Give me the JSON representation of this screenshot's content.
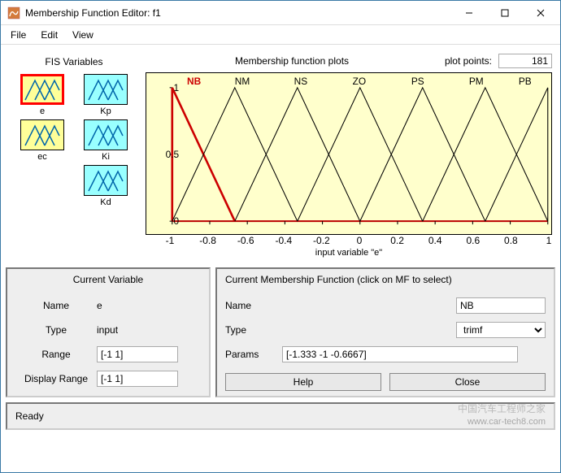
{
  "window": {
    "title": "Membership Function Editor: f1"
  },
  "menu": {
    "file": "File",
    "edit": "Edit",
    "view": "View"
  },
  "fis_header": "FIS Variables",
  "vars": [
    {
      "name": "e",
      "type": "input",
      "selected": true
    },
    {
      "name": "Kp",
      "type": "output",
      "selected": false
    },
    {
      "name": "ec",
      "type": "input",
      "selected": false
    },
    {
      "name": "Ki",
      "type": "output",
      "selected": false
    },
    {
      "name": "Kd",
      "type": "output",
      "selected": false
    }
  ],
  "plot": {
    "title": "Membership function plots",
    "points_label": "plot points:",
    "points_value": "181",
    "axis_label": "input variable \"e\""
  },
  "chart_data": {
    "type": "line",
    "title": "Membership function plots",
    "xlabel": "input variable \"e\"",
    "ylabel": "",
    "xlim": [
      -1,
      1
    ],
    "ylim": [
      0,
      1
    ],
    "xticks": [
      -1,
      -0.8,
      -0.6,
      -0.4,
      -0.2,
      0,
      0.2,
      0.4,
      0.6,
      0.8,
      1
    ],
    "yticks": [
      0,
      0.5,
      1
    ],
    "series": [
      {
        "name": "NB",
        "x": [
          -1.333,
          -1,
          -0.6667
        ],
        "y": [
          0,
          1,
          0
        ],
        "selected": true
      },
      {
        "name": "NM",
        "x": [
          -1,
          -0.6667,
          -0.3333
        ],
        "y": [
          0,
          1,
          0
        ]
      },
      {
        "name": "NS",
        "x": [
          -0.6667,
          -0.3333,
          0
        ],
        "y": [
          0,
          1,
          0
        ]
      },
      {
        "name": "ZO",
        "x": [
          -0.3333,
          0,
          0.3333
        ],
        "y": [
          0,
          1,
          0
        ]
      },
      {
        "name": "PS",
        "x": [
          0,
          0.3333,
          0.6667
        ],
        "y": [
          0,
          1,
          0
        ]
      },
      {
        "name": "PM",
        "x": [
          0.3333,
          0.6667,
          1
        ],
        "y": [
          0,
          1,
          0
        ]
      },
      {
        "name": "PB",
        "x": [
          0.6667,
          1,
          1.333
        ],
        "y": [
          0,
          1,
          0
        ]
      }
    ]
  },
  "current_var": {
    "title": "Current Variable",
    "name_label": "Name",
    "name_value": "e",
    "type_label": "Type",
    "type_value": "input",
    "range_label": "Range",
    "range_value": "[-1 1]",
    "disp_label": "Display Range",
    "disp_value": "[-1 1]"
  },
  "current_mf": {
    "title": "Current Membership Function (click on MF to select)",
    "name_label": "Name",
    "name_value": "NB",
    "type_label": "Type",
    "type_value": "trimf",
    "params_label": "Params",
    "params_value": "[-1.333 -1 -0.6667]",
    "help": "Help",
    "close": "Close"
  },
  "status": "Ready",
  "watermark1": "www.car-tech8.com",
  "watermark2": "中国汽车工程师之家"
}
